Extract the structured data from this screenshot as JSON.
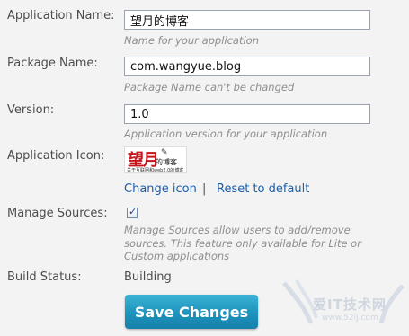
{
  "form": {
    "app_name": {
      "label": "Application Name:",
      "value": "望月的博客",
      "hint": "Name for your application"
    },
    "package_name": {
      "label": "Package Name:",
      "value": "com.wangyue.blog",
      "hint": "Package Name can't be changed"
    },
    "version": {
      "label": "Version:",
      "value": "1.0",
      "hint": "Application version for your application"
    },
    "app_icon": {
      "label": "Application Icon:",
      "icon_text": "望月",
      "icon_subtext": "的博客",
      "icon_tagline": "关于互联网和web2.0的博客",
      "change_link": "Change icon",
      "separator": "|",
      "reset_link": "Reset to default"
    },
    "manage_sources": {
      "label": "Manage Sources:",
      "checked": true,
      "hint": "Manage Sources allow users to add/remove sources. This feature only available for Lite or Custom applications"
    },
    "build_status": {
      "label": "Build Status:",
      "value": "Building"
    },
    "save_label": "Save Changes"
  },
  "watermark": {
    "text": "爱IT技术网",
    "url": "www.52ij.com"
  }
}
